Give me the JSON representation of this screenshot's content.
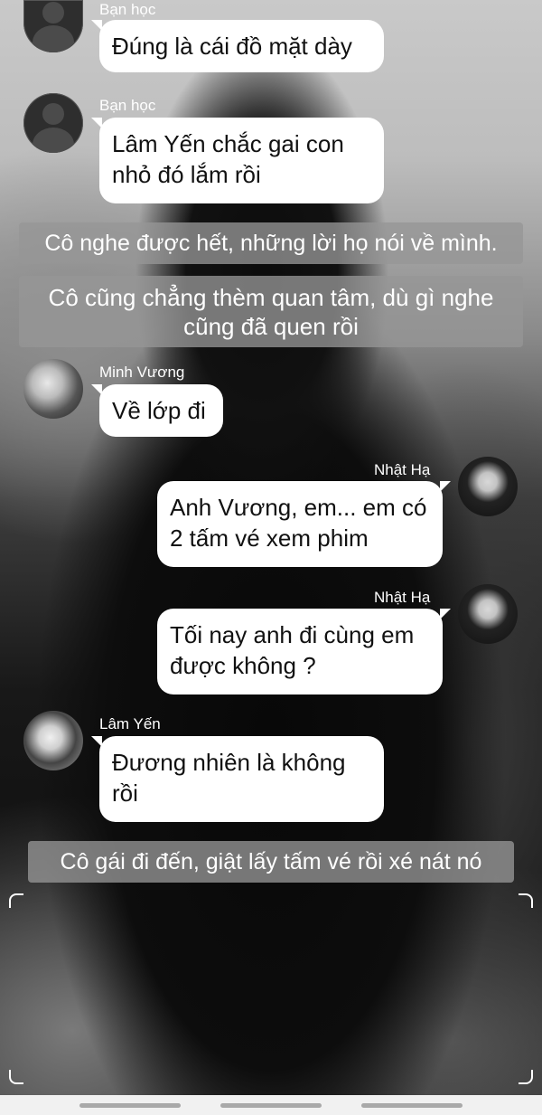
{
  "messages": [
    {
      "sender": "Bạn học",
      "text": "Đúng là cái đồ mặt dày",
      "side": "left",
      "avatar": "default-avatar-icon"
    },
    {
      "sender": "Bạn học",
      "text": "Lâm Yến chắc gai con nhỏ đó lắm rồi",
      "side": "left",
      "avatar": "default-avatar-icon"
    }
  ],
  "narration": [
    "Cô nghe được hết, những lời họ nói về mình.",
    "Cô cũng chẳng thèm quan tâm, dù gì nghe cũng đã quen rồi"
  ],
  "messages2": [
    {
      "sender": "Minh Vương",
      "text": "Về lớp đi",
      "side": "left"
    },
    {
      "sender": "Nhật Hạ",
      "text": "Anh Vương, em... em có 2 tấm vé xem phim",
      "side": "right"
    },
    {
      "sender": "Nhật Hạ",
      "text": "Tối nay anh đi cùng em được không ?",
      "side": "right"
    },
    {
      "sender": "Lâm Yến",
      "text": "Đương nhiên là không rồi",
      "side": "left"
    }
  ],
  "narration2": [
    "Cô gái đi đến, giật lấy tấm vé rồi xé nát nó"
  ],
  "colors": {
    "bubble": "#ffffff",
    "narration_bg": "#969696",
    "name_text": "#ffffff"
  }
}
